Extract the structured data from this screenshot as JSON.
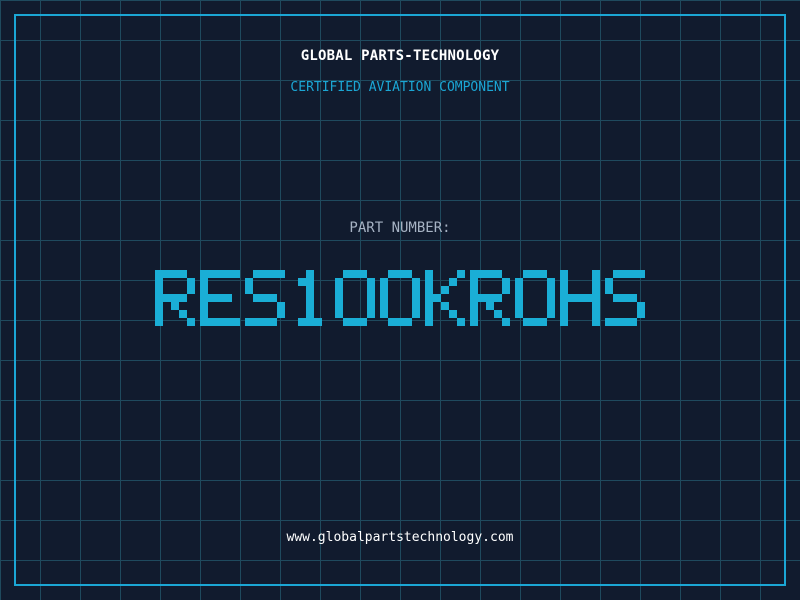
{
  "header": {
    "company_name": "GLOBAL PARTS-TECHNOLOGY",
    "subtitle": "CERTIFIED AVIATION COMPONENT"
  },
  "part": {
    "label": "PART NUMBER:",
    "number": "RES100KROHS"
  },
  "footer": {
    "website": "www.globalpartstechnology.com"
  },
  "colors": {
    "background": "#111b2e",
    "grid": "#1f4a5e",
    "accent": "#1ba6d4",
    "part_number": "#1aaed6"
  }
}
